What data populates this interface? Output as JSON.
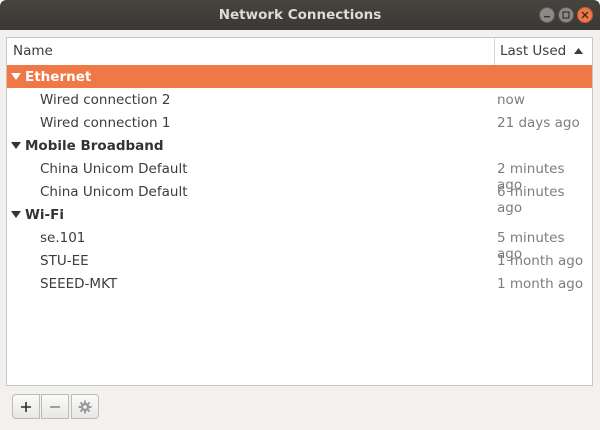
{
  "window": {
    "title": "Network Connections"
  },
  "columns": {
    "name": "Name",
    "last_used": "Last Used"
  },
  "groups": [
    {
      "label": "Ethernet",
      "items": [
        {
          "name": "Wired connection 2",
          "last_used": "now"
        },
        {
          "name": "Wired connection 1",
          "last_used": "21 days ago"
        }
      ]
    },
    {
      "label": "Mobile Broadband",
      "items": [
        {
          "name": "China Unicom Default",
          "last_used": "2 minutes ago"
        },
        {
          "name": "China Unicom Default",
          "last_used": "6 minutes ago"
        }
      ]
    },
    {
      "label": "Wi-Fi",
      "items": [
        {
          "name": "se.101",
          "last_used": "5 minutes ago"
        },
        {
          "name": "STU-EE",
          "last_used": "1 month ago"
        },
        {
          "name": "SEEED-MKT",
          "last_used": "1 month ago"
        }
      ]
    }
  ],
  "selected_group": "Ethernet",
  "toolbar": {
    "add": "+",
    "remove": "−"
  },
  "icons": {
    "close": "close-icon",
    "minimize": "minimize-icon",
    "maximize": "maximize-icon",
    "expand": "triangle-down-icon",
    "sort": "sort-ascending-icon",
    "settings": "gear-icon"
  },
  "colors": {
    "accent": "#f07746",
    "titlebar": "#3f3e3a",
    "secondary_text": "#7d7d7d"
  }
}
